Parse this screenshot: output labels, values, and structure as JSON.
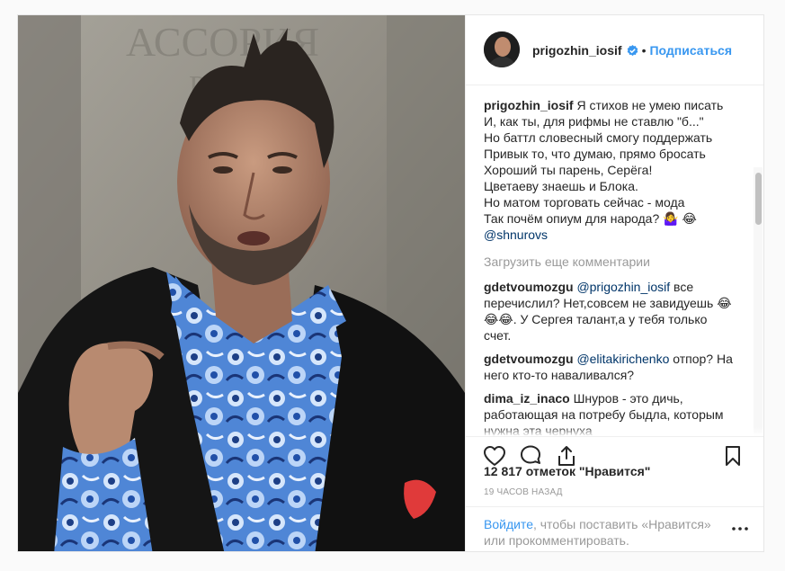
{
  "post": {
    "username": "prigozhin_iosif",
    "separator": "•",
    "follow_label": "Подписаться",
    "caption_lines": [
      "Я стихов не умею писать",
      "И, как ты, для рифмы не ставлю \"б...\"",
      "Но баттл словесный смогу поддержать",
      "Привык то, что думаю, прямо бросать",
      "Хороший ты парень, Серёга!",
      "Цветаеву знаешь и Блока.",
      "Но матом торговать сейчас - мода",
      "Так почём опиум для народа? 🤷‍♀️ 😂"
    ],
    "caption_mention": "@shnurovs",
    "load_more_label": "Загрузить еще комментарии",
    "comments": [
      {
        "author": "gdetvoumozgu",
        "mention": "@prigozhin_iosif",
        "text": "все перечислил? Нет,совсем не завидуешь 😂😂😂. У Сергея талант,а у тебя только счет."
      },
      {
        "author": "gdetvoumozgu",
        "mention": "@elitakirichenko",
        "text": "отпор? На него кто-то наваливался?"
      },
      {
        "author": "dima_iz_inaco",
        "mention": "",
        "text": "Шнуров - это дичь, работающая на потребу быдла, которым нужна эта чернуха"
      }
    ],
    "likes_label": "12 817 отметок \"Нравится\"",
    "time_label": "19 ЧАСОВ НАЗАД",
    "login_link": "Войдите",
    "login_rest": ", чтобы поставить «Нравится» или прокомментировать."
  },
  "icons": {
    "verified": "verified-badge-icon",
    "like": "heart-icon",
    "comment": "comment-bubble-icon",
    "share": "share-icon",
    "save": "bookmark-icon",
    "more": "more-options-icon"
  },
  "colors": {
    "accent": "#3897f0",
    "mention": "#003569",
    "muted": "#999999",
    "text": "#262626",
    "border": "#efefef"
  }
}
